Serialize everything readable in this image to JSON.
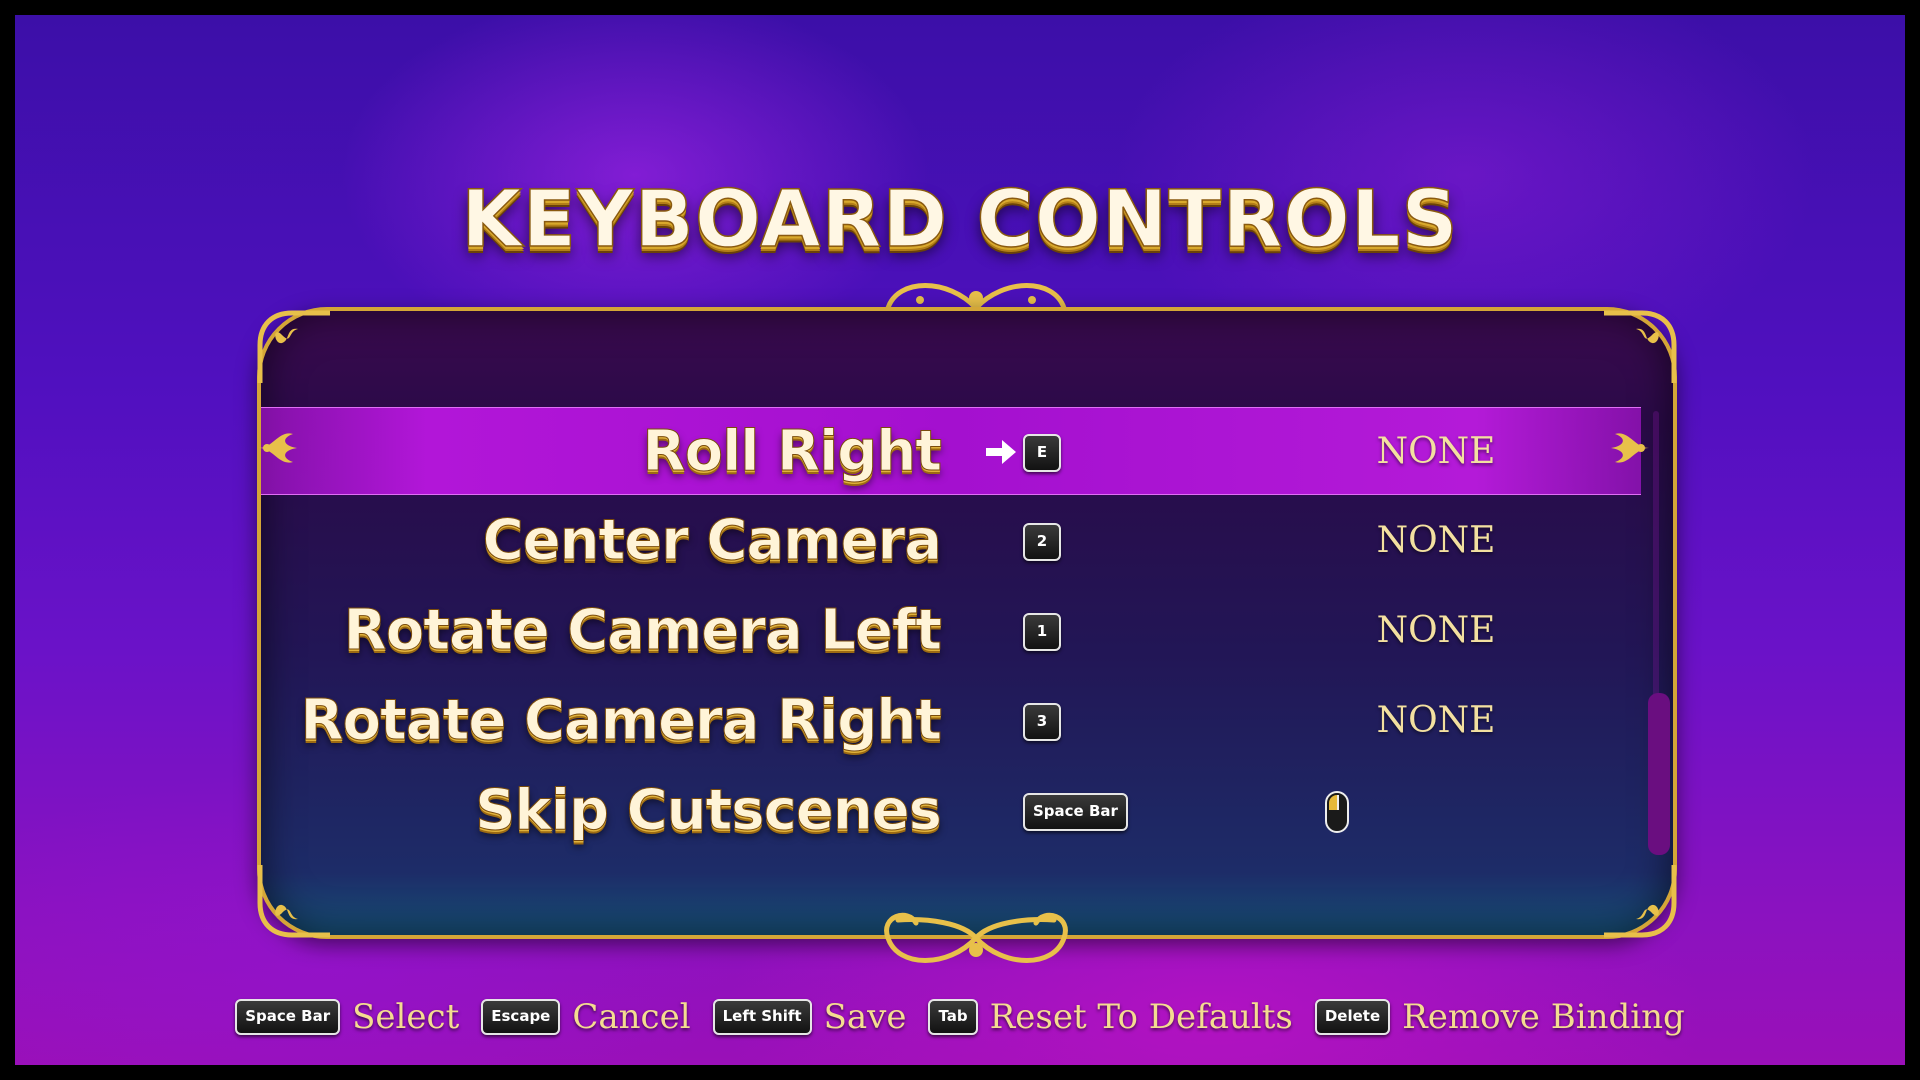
{
  "screen": {
    "title": "KEYBOARD CONTROLS"
  },
  "rows": [
    {
      "action": "Roll Right",
      "primary": "E",
      "secondary": "NONE",
      "selected": true
    },
    {
      "action": "Center Camera",
      "primary": "2",
      "secondary": "NONE",
      "selected": false
    },
    {
      "action": "Rotate Camera Left",
      "primary": "1",
      "secondary": "NONE",
      "selected": false
    },
    {
      "action": "Rotate Camera Right",
      "primary": "3",
      "secondary": "NONE",
      "selected": false
    },
    {
      "action": "Skip Cutscenes",
      "primary": "Space Bar",
      "secondary_icon": "mouse-left-click-icon",
      "selected": false
    }
  ],
  "footer": [
    {
      "key": "Space Bar",
      "label": "Select"
    },
    {
      "key": "Escape",
      "label": "Cancel"
    },
    {
      "key": "Left Shift",
      "label": "Save"
    },
    {
      "key": "Tab",
      "label": "Reset To Defaults"
    },
    {
      "key": "Delete",
      "label": "Remove Binding"
    }
  ],
  "colors": {
    "accent_gold": "#d4a637",
    "selected_row": "#a410cf",
    "binding_text": "#f3e0a0"
  },
  "icons": [
    "flourish-ornament-icon",
    "fleur-de-lis-icon",
    "selection-arrow-icon",
    "mouse-left-click-icon"
  ]
}
